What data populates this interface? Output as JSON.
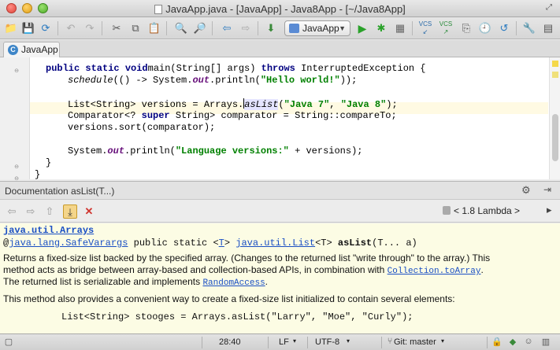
{
  "window": {
    "title": "JavaApp.java - [JavaApp] - Java8App - [~/Java8App]"
  },
  "toolbar": {
    "run_configuration": "JavaApp",
    "vcs_label": "VCS",
    "icons": [
      "open-folder-icon",
      "save-icon",
      "sync-icon",
      "undo-icon",
      "redo-icon",
      "cut-icon",
      "copy-icon",
      "paste-icon",
      "find-icon",
      "replace-icon",
      "back-icon",
      "forward-icon",
      "build-icon",
      "run-icon",
      "debug-icon",
      "coverage-icon",
      "stop-icon",
      "vcs-update-icon",
      "vcs-commit-icon",
      "vcs-compare-icon",
      "history-icon",
      "revert-icon",
      "settings-icon",
      "project-structure-icon",
      "help-icon"
    ]
  },
  "editor": {
    "tab_label": "JavaApp",
    "lines": [
      {
        "parts": [
          [
            "kw",
            "public static void"
          ],
          [
            "",
            "main(String[] args) "
          ],
          [
            "kw",
            "throws"
          ],
          [
            "",
            " InterruptedException {"
          ]
        ]
      },
      {
        "parts": [
          [
            "it",
            "schedule"
          ],
          [
            "",
            "(() -> System."
          ],
          [
            "ital-field",
            "out"
          ],
          [
            "",
            ".println("
          ],
          [
            "str",
            "\"Hello world!\""
          ],
          [
            "",
            "));"
          ]
        ]
      },
      {
        "parts": [
          [
            "",
            ""
          ]
        ]
      },
      {
        "parts": [
          [
            "",
            "List<String> versions = Arrays."
          ],
          [
            "caret",
            ""
          ],
          [
            "hl",
            "asList"
          ],
          [
            "",
            "("
          ],
          [
            "str",
            "\"Java 7\""
          ],
          [
            "",
            ", "
          ],
          [
            "str",
            "\"Java 8\""
          ],
          [
            "",
            ");"
          ]
        ]
      },
      {
        "parts": [
          [
            "",
            "Comparator<? "
          ],
          [
            "kw",
            "super"
          ],
          [
            "",
            " String> comparator = String::compareTo;"
          ]
        ]
      },
      {
        "parts": [
          [
            "",
            "versions.sort(comparator);"
          ]
        ]
      },
      {
        "parts": [
          [
            "",
            ""
          ]
        ]
      },
      {
        "parts": [
          [
            "",
            "System."
          ],
          [
            "ital-field",
            "out"
          ],
          [
            "",
            ".println("
          ],
          [
            "str",
            "\"Language versions:\""
          ],
          [
            "",
            " + versions);"
          ]
        ]
      },
      {
        "parts": [
          [
            "",
            "}"
          ]
        ]
      },
      {
        "parts": [
          [
            "",
            "}"
          ]
        ]
      }
    ]
  },
  "doc": {
    "header_label": "Documentation asList(T...)",
    "language_level": "< 1.8 Lambda >",
    "package": "java.util.Arrays",
    "signature": {
      "annotation": "@",
      "annotation_link": "java.lang.SafeVarargs",
      "modifiers": " public static <",
      "type_param": "T",
      "close": "> ",
      "return_link": "java.util.List",
      "return_rest": "<T> ",
      "method": "asList",
      "params": "(T... a)"
    },
    "para1_line1": "Returns a fixed-size list backed by the specified array. (Changes to the returned list \"write through\" to the array.) This",
    "para1_line2_pre": "method acts as bridge between array-based and collection-based APIs, in combination with ",
    "para1_line2_link": "Collection.toArray",
    "para1_line2_post": ".",
    "para1_line3_pre": "The returned list is serializable and implements ",
    "para1_line3_link": "RandomAccess",
    "para1_line3_post": ".",
    "para2": "This method also provides a convenient way to create a fixed-size list initialized to contain several elements:",
    "example": "List<String> stooges = Arrays.asList(\"Larry\", \"Moe\", \"Curly\");"
  },
  "status": {
    "position": "28:40",
    "line_separator": "LF",
    "encoding": "UTF-8",
    "vcs_branch": "Git: master"
  }
}
